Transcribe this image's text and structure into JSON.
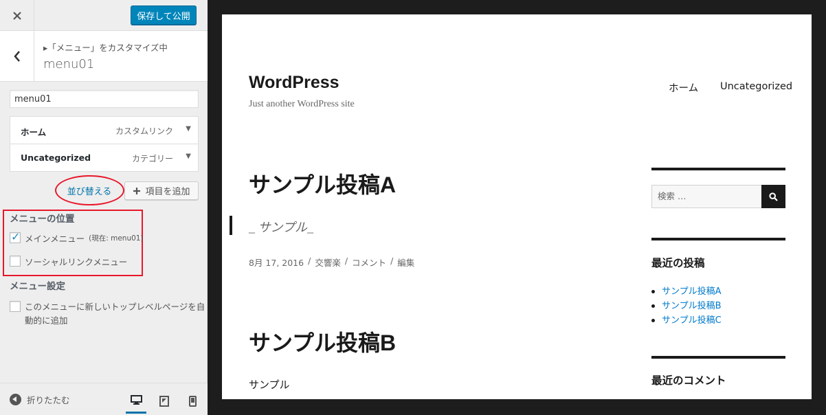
{
  "topbar": {
    "close_icon": "close-icon",
    "publish_label": "保存して公開"
  },
  "section": {
    "customizing_label": "▸「メニュー」をカスタマイズ中",
    "title": "menu01",
    "back_icon": "chevron-left-icon"
  },
  "menu_name": {
    "value": "menu01"
  },
  "menu_items": [
    {
      "title": "ホーム",
      "type": "カスタムリンク"
    },
    {
      "title": "Uncategorized",
      "type": "カテゴリー"
    }
  ],
  "actions": {
    "reorder_label": "並び替える",
    "add_item_label": "項目を追加"
  },
  "locations": {
    "heading": "メニューの位置",
    "items": [
      {
        "label": "メインメニュー",
        "note": "(現在: menu01)",
        "checked": true
      },
      {
        "label": "ソーシャルリンクメニュー",
        "checked": false
      }
    ]
  },
  "settings": {
    "heading": "メニュー設定",
    "auto_add_label_line1": "このメニューに新しいトップレベルページを自",
    "auto_add_label_line2": "動的に追加",
    "auto_add_checked": false
  },
  "footer": {
    "collapse_label": "折りたたむ",
    "devices": [
      "desktop-icon",
      "tablet-icon",
      "mobile-icon"
    ],
    "active_device": "desktop"
  },
  "preview": {
    "site_title": "WordPress",
    "site_description": "Just another WordPress site",
    "nav": [
      "ホーム",
      "Uncategorized"
    ],
    "posts": [
      {
        "title": "サンプル投稿A",
        "excerpt": "_ サンプル_",
        "meta": {
          "date": "8月 17, 2016",
          "author": "交響楽",
          "comments": "コメント",
          "edit": "編集",
          "sep": "/"
        }
      },
      {
        "title": "サンプル投稿B",
        "content": "サンプル"
      }
    ],
    "search_placeholder": "検索 …",
    "recent_posts_title": "最近の投稿",
    "recent_posts": [
      "サンプル投稿A",
      "サンプル投稿B",
      "サンプル投稿C"
    ],
    "recent_comments_title": "最近のコメント"
  },
  "colors": {
    "accent": "#0073aa",
    "publish": "#0085ba",
    "highlight_red": "#e8162a",
    "link": "#007acc"
  }
}
